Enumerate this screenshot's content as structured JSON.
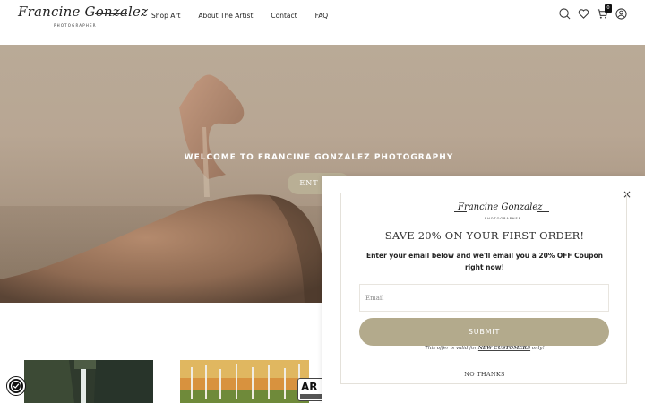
{
  "header": {
    "logo_text": "Francine Gonzalez",
    "logo_subtitle": "PHOTOGRAPHER",
    "nav": [
      "Shop Art",
      "About The Artist",
      "Contact",
      "FAQ"
    ],
    "cart_count": "0",
    "icons": [
      "search-icon",
      "heart-icon",
      "cart-icon",
      "account-icon"
    ]
  },
  "hero": {
    "title": "WELCOME TO FRANCINE GONZALEZ PHOTOGRAPHY",
    "button_label": "ENT"
  },
  "badge": {
    "text": "AR"
  },
  "popup": {
    "logo_text": "Francine Gonzalez",
    "logo_subtitle": "PHOTOGRAPHER",
    "title": "SAVE 20% ON YOUR FIRST ORDER!",
    "description": "Enter your email below and we'll email you a 20% OFF Coupon right now!",
    "email_placeholder": "Email",
    "submit_label": "SUBMIT",
    "note_prefix": "This offer is valid for ",
    "note_highlight": "NEW CUSTOMERS",
    "note_suffix": " only!",
    "no_thanks": "NO THANKS",
    "close_symbol": "×"
  },
  "colors": {
    "accent": "#b3aa8c",
    "hero_bg": "#b8a693"
  }
}
